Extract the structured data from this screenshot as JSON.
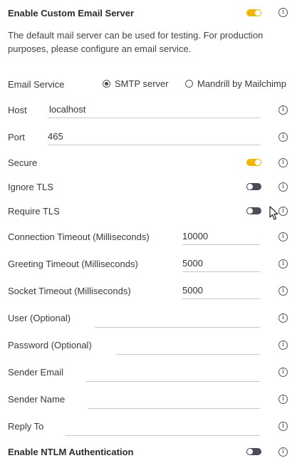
{
  "header": {
    "title": "Enable Custom Email Server",
    "enabled": true,
    "description": "The default mail server can be used for testing. For production purposes, please configure an email service."
  },
  "email_service": {
    "label": "Email Service",
    "options": [
      "SMTP server",
      "Mandrill by Mailchimp"
    ],
    "selected": "SMTP server"
  },
  "fields": {
    "host": {
      "label": "Host",
      "value": "localhost"
    },
    "port": {
      "label": "Port",
      "value": "465"
    },
    "secure": {
      "label": "Secure",
      "enabled": true
    },
    "ignore_tls": {
      "label": "Ignore TLS",
      "enabled": false
    },
    "require_tls": {
      "label": "Require TLS",
      "enabled": false
    },
    "connection_timeout": {
      "label": "Connection Timeout (Milliseconds)",
      "value": "10000"
    },
    "greeting_timeout": {
      "label": "Greeting Timeout (Milliseconds)",
      "value": "5000"
    },
    "socket_timeout": {
      "label": "Socket Timeout (Milliseconds)",
      "value": "5000"
    },
    "user": {
      "label": "User (Optional)",
      "value": ""
    },
    "password": {
      "label": "Password (Optional)",
      "value": ""
    },
    "sender_email": {
      "label": "Sender Email",
      "value": ""
    },
    "sender_name": {
      "label": "Sender Name",
      "value": ""
    },
    "reply_to": {
      "label": "Reply To",
      "value": ""
    }
  },
  "ntlm": {
    "label": "Enable NTLM Authentication",
    "enabled": false
  },
  "icons": {
    "info": "info-icon",
    "cursor": "mouse-pointer-icon"
  },
  "colors": {
    "toggle_on": "#f2b705",
    "toggle_off": "#4a4f57"
  }
}
